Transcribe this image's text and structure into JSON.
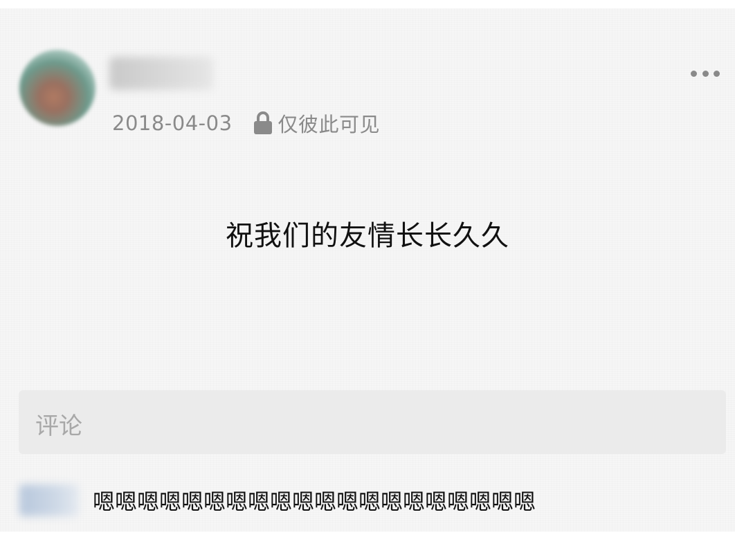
{
  "post": {
    "author": {
      "name": "",
      "avatar": "blurred-avatar"
    },
    "date": "2018-04-03",
    "visibility_icon": "lock-icon",
    "visibility": "仅彼此可见",
    "more_icon": "more-dots-icon",
    "content": "祝我们的友情长长久久"
  },
  "comment_input": {
    "placeholder": "评论"
  },
  "comments": [
    {
      "author": "",
      "text": "嗯嗯嗯嗯嗯嗯嗯嗯嗯嗯嗯嗯嗯嗯嗯嗯嗯嗯嗯嗯"
    }
  ],
  "colors": {
    "background": "#f6f6f6",
    "secondary_text": "#8a8a8a",
    "primary_text": "#111111",
    "comment_box": "#ebebeb"
  }
}
